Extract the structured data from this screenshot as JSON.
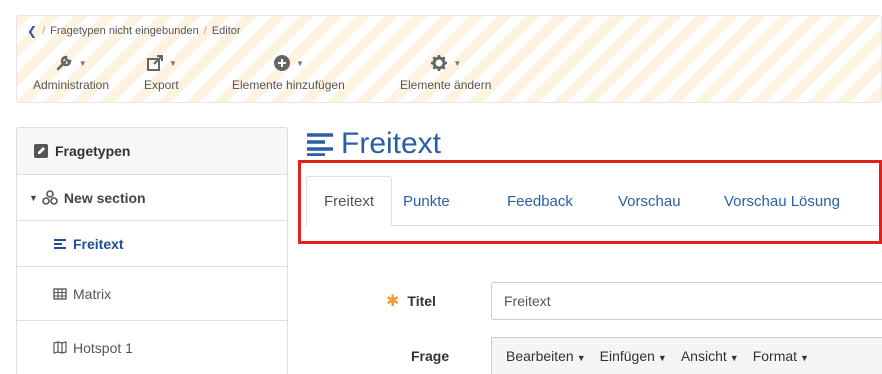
{
  "breadcrumb": {
    "items": [
      "Fragetypen nicht eingebunden",
      "Editor"
    ]
  },
  "toolbar": {
    "administration": "Administration",
    "export": "Export",
    "add_elements": "Elemente hinzufügen",
    "change_elements": "Elemente ändern"
  },
  "sidebar": {
    "header": "Fragetypen",
    "section": "New section",
    "items": [
      {
        "label": "Freitext",
        "icon": "align-left-icon",
        "active": true
      },
      {
        "label": "Matrix",
        "icon": "table-icon",
        "active": false
      },
      {
        "label": "Hotspot 1",
        "icon": "map-icon",
        "active": false
      }
    ]
  },
  "main": {
    "title": "Freitext",
    "tabs": [
      "Freitext",
      "Punkte",
      "Feedback",
      "Vorschau",
      "Vorschau Lösung"
    ],
    "active_tab": "Freitext"
  },
  "form": {
    "title_label": "Titel",
    "title_value": "Freitext",
    "question_label": "Frage"
  },
  "editor_menu": [
    "Bearbeiten",
    "Einfügen",
    "Ansicht",
    "Format"
  ],
  "colors": {
    "link": "#2a5fa8",
    "highlight": "#e3211b",
    "required": "#f0a030"
  }
}
